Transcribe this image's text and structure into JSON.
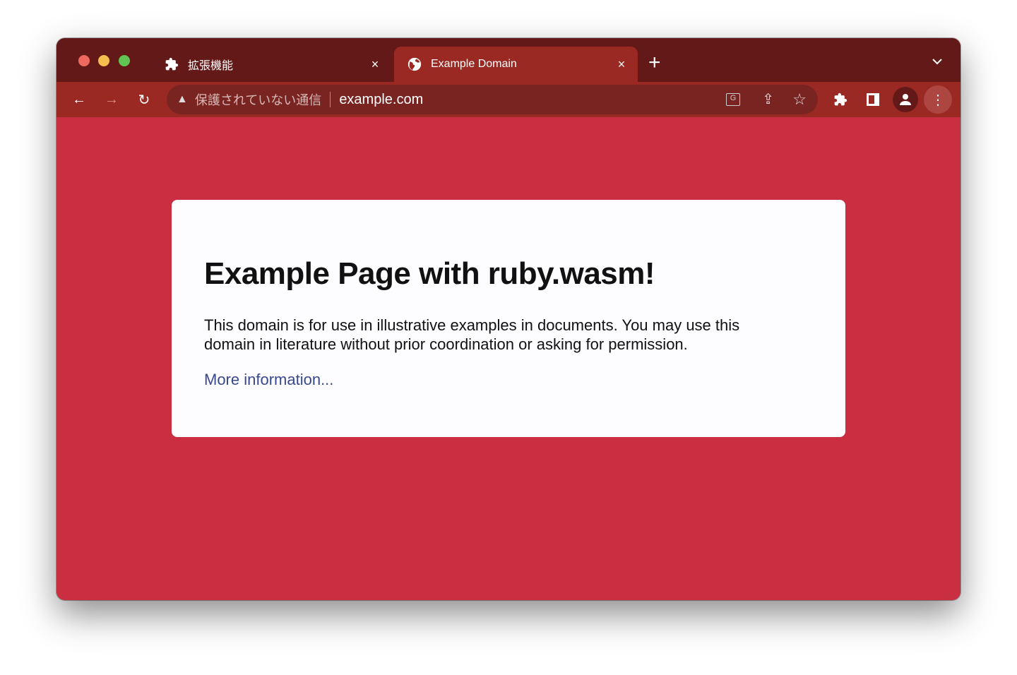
{
  "tabs": [
    {
      "label": "拡張機能",
      "icon": "puzzle-icon",
      "close": "×"
    },
    {
      "label": "Example Domain",
      "icon": "globe-icon",
      "close": "×"
    }
  ],
  "new_tab": "+",
  "tab_menu": "⌄",
  "address": {
    "security_label": "保護されていない通信",
    "url": "example.com"
  },
  "page": {
    "heading": "Example Page with ruby.wasm!",
    "body": "This domain is for use in illustrative examples in documents. You may use this domain in literature without prior coordination or asking for permission.",
    "link": "More information..."
  },
  "colors": {
    "frame": "#621917",
    "toolbar": "#9a2924",
    "page_bg": "#ca2f41",
    "link": "#38488f"
  }
}
